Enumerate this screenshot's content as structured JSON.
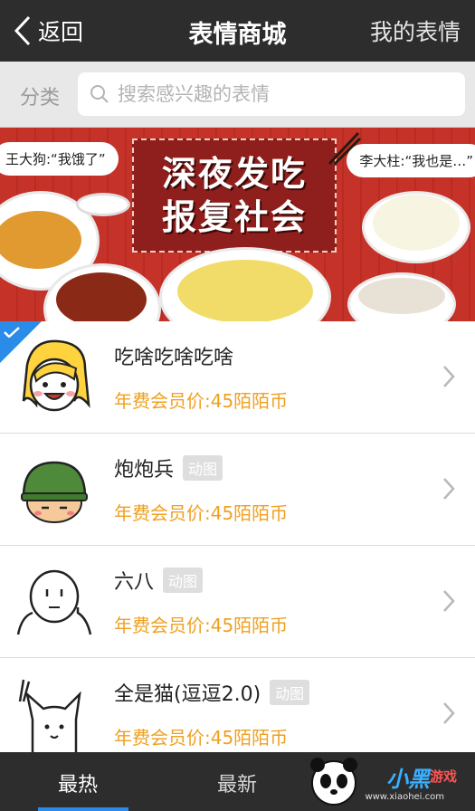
{
  "nav": {
    "back_label": "返回",
    "title": "表情商城",
    "right_label": "我的表情"
  },
  "search": {
    "category_label": "分类",
    "placeholder": "搜索感兴趣的表情"
  },
  "banner": {
    "headline_line1": "深夜发吃",
    "headline_line2": "报复社会",
    "bubble_left": "王大狗:“我饿了”",
    "bubble_right": "李大柱:“我也是…”"
  },
  "items": [
    {
      "name": "吃啥吃啥吃啥",
      "badge": "",
      "price": "年费会员价:45陌陌币",
      "selected": true
    },
    {
      "name": "炮炮兵",
      "badge": "动图",
      "price": "年费会员价:45陌陌币",
      "selected": false
    },
    {
      "name": "六八",
      "badge": "动图",
      "price": "年费会员价:45陌陌币",
      "selected": false
    },
    {
      "name": "全是猫(逗逗2.0)",
      "badge": "动图",
      "price": "年费会员价:45陌陌币",
      "selected": false
    }
  ],
  "tabs": {
    "hot": "最热",
    "new": "最新"
  },
  "watermark": {
    "text": "小黑",
    "text2": "游戏",
    "url": "www.xiaohei.com"
  },
  "colors": {
    "accent": "#2a8ce8",
    "price": "#f0a020",
    "navbar": "#2d2d2d"
  }
}
